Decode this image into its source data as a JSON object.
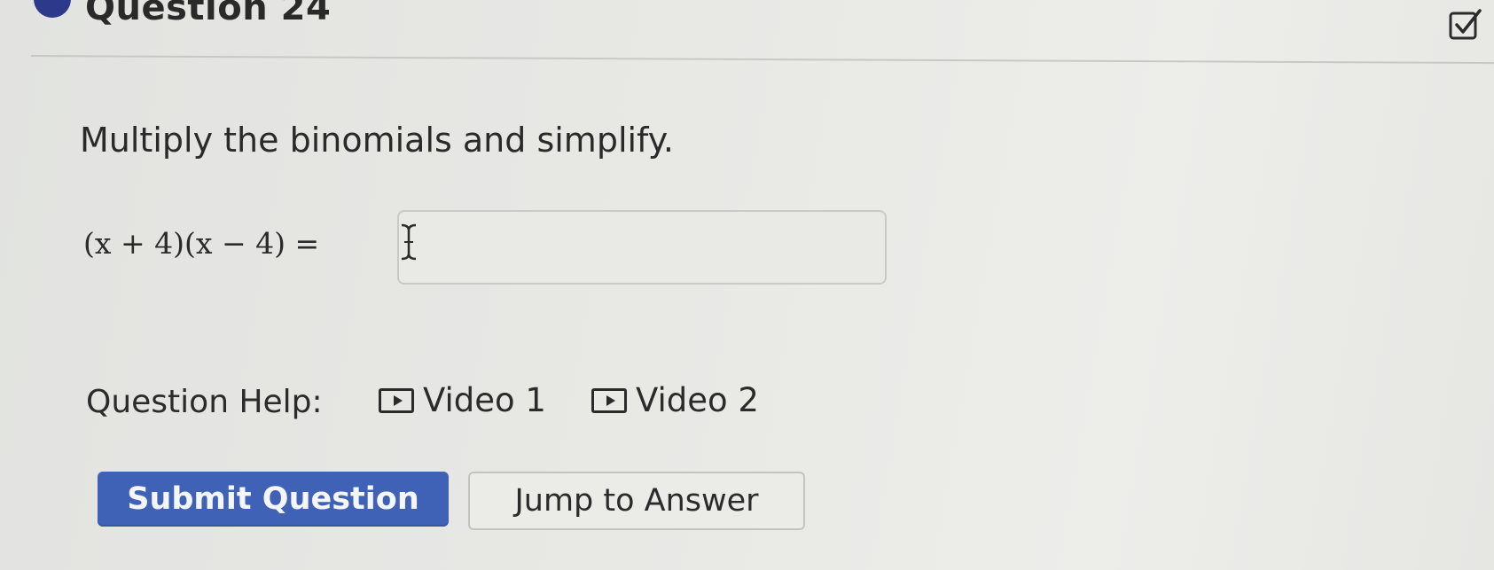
{
  "question": {
    "title": "Question 24",
    "prompt": "Multiply the binomials and simplify.",
    "expression": "(x + 4)(x − 4) =",
    "answer_value": ""
  },
  "help": {
    "label": "Question Help:",
    "videos": [
      {
        "label": "Video 1",
        "icon": "play-icon"
      },
      {
        "label": "Video 2",
        "icon": "play-icon"
      }
    ]
  },
  "buttons": {
    "submit": "Submit Question",
    "jump": "Jump to Answer"
  },
  "icons": {
    "status": "checkbox-icon",
    "cursor": "text-cursor-icon"
  },
  "colors": {
    "accent": "#3f62b6",
    "status_dot": "#2d3a8c"
  }
}
